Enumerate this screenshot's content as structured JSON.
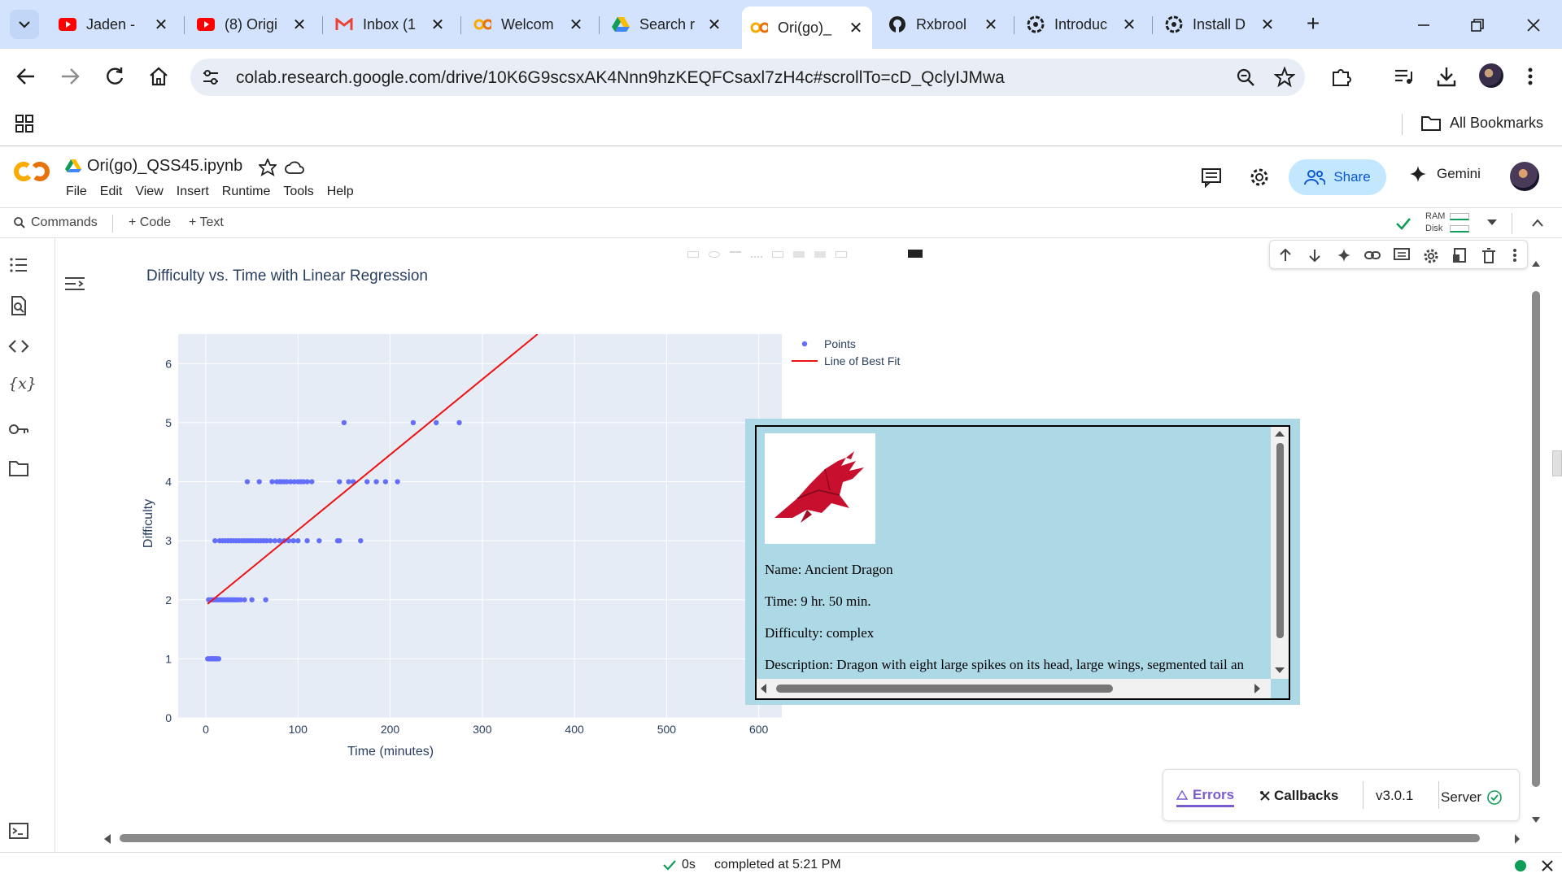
{
  "browser": {
    "tabs": [
      {
        "title": "Jaden -",
        "icon": "youtube-icon"
      },
      {
        "title": "(8) Origi",
        "icon": "youtube-icon"
      },
      {
        "title": "Inbox (1",
        "icon": "gmail-icon"
      },
      {
        "title": "Welcom",
        "icon": "colab-icon"
      },
      {
        "title": "Search r",
        "icon": "google-drive-icon"
      },
      {
        "title": "Ori(go)_",
        "icon": "colab-icon"
      },
      {
        "title": "Rxbrool",
        "icon": "github-icon"
      },
      {
        "title": "Introduc",
        "icon": "openai-icon"
      },
      {
        "title": "Install D",
        "icon": "openai-icon"
      }
    ],
    "active_tab": 5,
    "url": "colab.research.google.com/drive/10K6G9scsxAK4Nnn9hzKEQFCsaxl7zH4c#scrollTo=cD_QclyIJMwa",
    "bookmarks_label": "All Bookmarks"
  },
  "colab": {
    "notebook_title": "Ori(go)_QSS45.ipynb",
    "menu": [
      "File",
      "Edit",
      "View",
      "Insert",
      "Runtime",
      "Tools",
      "Help"
    ],
    "share_label": "Share",
    "gemini_label": "Gemini",
    "commands_label": "Commands",
    "code_label": "+ Code",
    "text_label": "+ Text",
    "ram_label": "RAM",
    "disk_label": "Disk"
  },
  "chart_data": {
    "type": "scatter",
    "title": "Difficulty vs. Time with Linear Regression",
    "xlabel": "Time (minutes)",
    "ylabel": "Difficulty",
    "xlim": [
      -30,
      625
    ],
    "ylim": [
      0,
      6.5
    ],
    "xticks": [
      0,
      100,
      200,
      300,
      400,
      500,
      600
    ],
    "yticks": [
      0,
      1,
      2,
      3,
      4,
      5,
      6
    ],
    "grid": true,
    "legend_position": "top-right",
    "series": [
      {
        "name": "Points",
        "mode": "markers",
        "color": "#636efa",
        "points": [
          [
            2,
            1
          ],
          [
            4,
            1
          ],
          [
            5,
            1
          ],
          [
            6,
            1
          ],
          [
            7,
            1
          ],
          [
            8,
            1
          ],
          [
            9,
            1
          ],
          [
            10,
            1
          ],
          [
            11,
            1
          ],
          [
            12,
            1
          ],
          [
            14,
            1
          ],
          [
            3,
            2
          ],
          [
            5,
            2
          ],
          [
            7,
            2
          ],
          [
            9,
            2
          ],
          [
            11,
            2
          ],
          [
            13,
            2
          ],
          [
            15,
            2
          ],
          [
            17,
            2
          ],
          [
            19,
            2
          ],
          [
            21,
            2
          ],
          [
            23,
            2
          ],
          [
            25,
            2
          ],
          [
            27,
            2
          ],
          [
            29,
            2
          ],
          [
            31,
            2
          ],
          [
            33,
            2
          ],
          [
            35,
            2
          ],
          [
            38,
            2
          ],
          [
            42,
            2
          ],
          [
            50,
            2
          ],
          [
            65,
            2
          ],
          [
            10,
            3
          ],
          [
            15,
            3
          ],
          [
            18,
            3
          ],
          [
            21,
            3
          ],
          [
            24,
            3
          ],
          [
            27,
            3
          ],
          [
            30,
            3
          ],
          [
            33,
            3
          ],
          [
            36,
            3
          ],
          [
            39,
            3
          ],
          [
            42,
            3
          ],
          [
            45,
            3
          ],
          [
            48,
            3
          ],
          [
            51,
            3
          ],
          [
            54,
            3
          ],
          [
            57,
            3
          ],
          [
            60,
            3
          ],
          [
            63,
            3
          ],
          [
            66,
            3
          ],
          [
            70,
            3
          ],
          [
            75,
            3
          ],
          [
            80,
            3
          ],
          [
            85,
            3
          ],
          [
            90,
            3
          ],
          [
            95,
            3
          ],
          [
            100,
            3
          ],
          [
            110,
            3
          ],
          [
            123,
            3
          ],
          [
            143,
            3
          ],
          [
            145,
            3
          ],
          [
            168,
            3
          ],
          [
            45,
            4
          ],
          [
            58,
            4
          ],
          [
            72,
            4
          ],
          [
            77,
            4
          ],
          [
            80,
            4
          ],
          [
            82,
            4
          ],
          [
            85,
            4
          ],
          [
            88,
            4
          ],
          [
            92,
            4
          ],
          [
            96,
            4
          ],
          [
            100,
            4
          ],
          [
            103,
            4
          ],
          [
            106,
            4
          ],
          [
            110,
            4
          ],
          [
            115,
            4
          ],
          [
            145,
            4
          ],
          [
            155,
            4
          ],
          [
            160,
            4
          ],
          [
            175,
            4
          ],
          [
            185,
            4
          ],
          [
            195,
            4
          ],
          [
            208,
            4
          ],
          [
            150,
            5
          ],
          [
            225,
            5
          ],
          [
            250,
            5
          ],
          [
            275,
            5
          ]
        ]
      },
      {
        "name": "Line of Best Fit",
        "mode": "line",
        "color": "#ee1111",
        "points": [
          [
            2,
            1.93
          ],
          [
            360,
            6.5
          ]
        ]
      }
    ]
  },
  "popup": {
    "image_icon": "red-dragon-origami-image",
    "name_line": "Name: Ancient Dragon",
    "time_line": "Time: 9 hr. 50 min.",
    "difficulty_line": "Difficulty: complex",
    "description_line": "Description: Dragon with eight large spikes on its head, large wings, segmented tail an"
  },
  "dash": {
    "errors_label": "Errors",
    "callbacks_label": "Callbacks",
    "version_label": "v3.0.1",
    "server_label": "Server"
  },
  "status": {
    "elapsed": "0s",
    "completed": "completed at 5:21 PM"
  }
}
